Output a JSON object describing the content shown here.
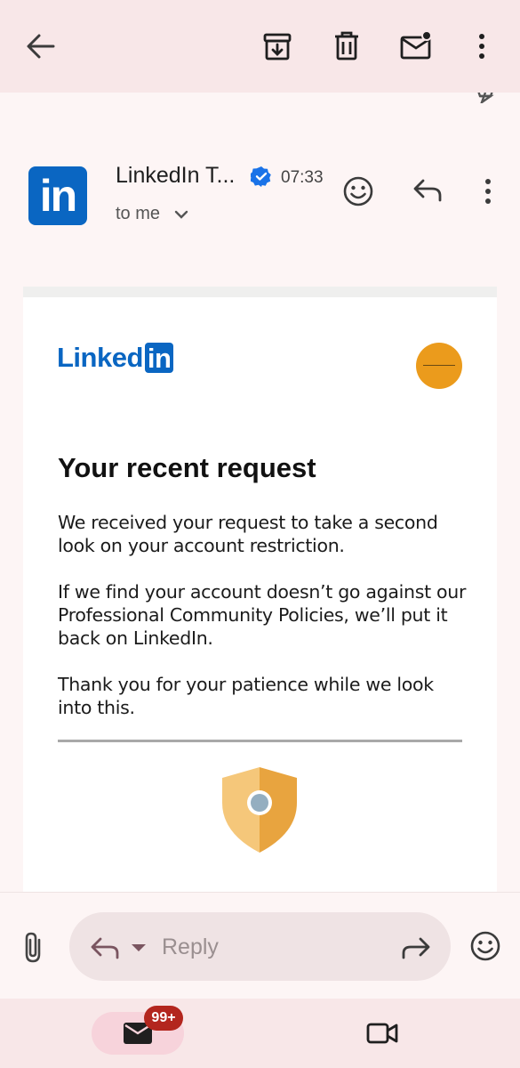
{
  "toolbar": {
    "back_icon": "arrow-left-icon",
    "archive_icon": "archive-icon",
    "delete_icon": "trash-icon",
    "mark_unread_icon": "mail-unread-icon",
    "more_icon": "more-vert-icon"
  },
  "message": {
    "sender_name": "LinkedIn T...",
    "verified_icon": "verified-badge-icon",
    "time": "07:33",
    "recipient": "to me",
    "avatar_text": "in"
  },
  "email_body": {
    "logo_text": "Linked",
    "logo_box_text": "in",
    "headline": "Your recent request",
    "paragraphs": [
      "We received your request to take a second look on your account restriction.",
      "If we find your account doesn’t go against our Professional Community Policies, we’ll put it back on LinkedIn.",
      "Thank you for your patience while we look into this."
    ]
  },
  "reply_bar": {
    "reply_placeholder": "Reply"
  },
  "bottom_nav": {
    "mail_badge": "99+"
  },
  "colors": {
    "linkedin_blue": "#0a66c2",
    "toolbar_bg": "#f8e7e8",
    "shield_light": "#f5c77a",
    "shield_dark": "#e8a43f",
    "badge_red": "#b3261e"
  }
}
